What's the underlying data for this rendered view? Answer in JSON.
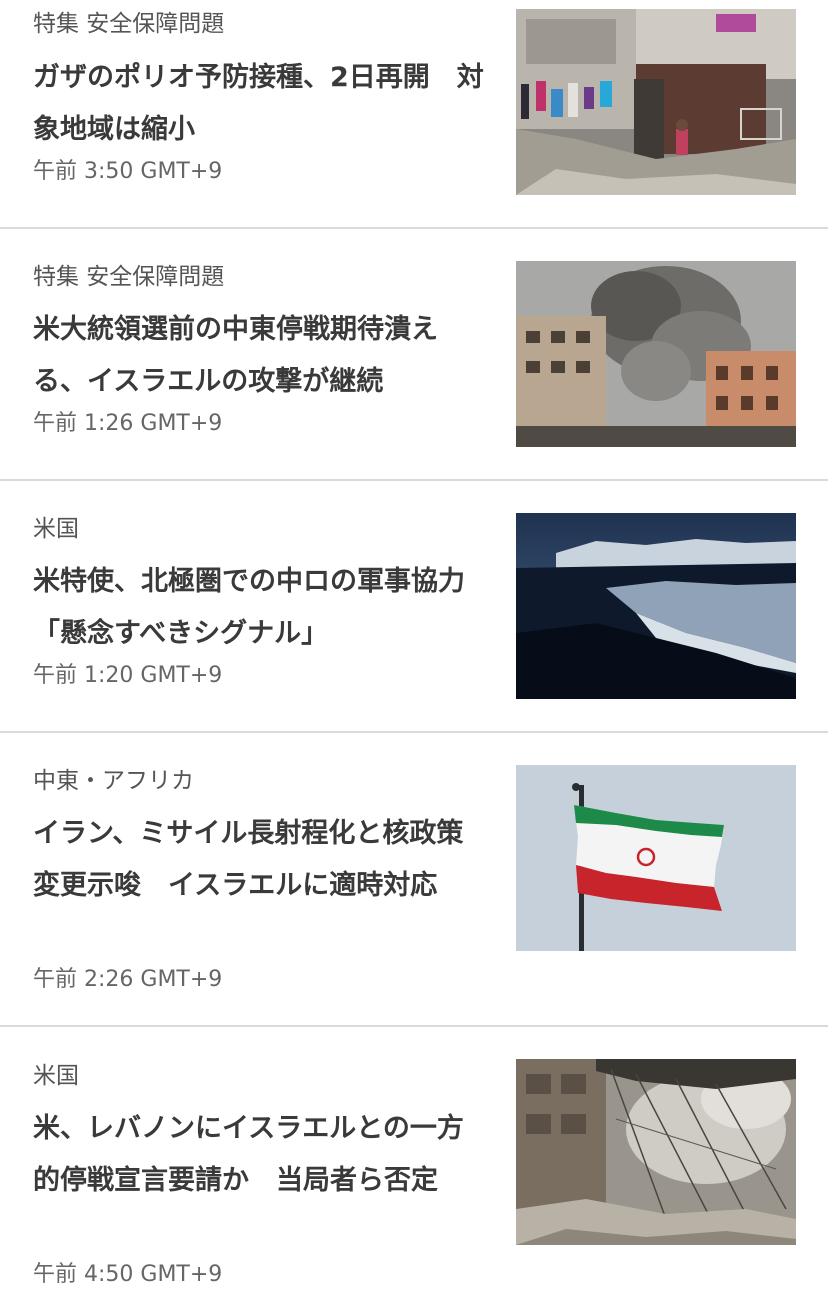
{
  "articles": [
    {
      "category": "特集 安全保障問題",
      "headline": "ガザのポリオ予防接種、2日再開　対象地域は縮小",
      "timestamp": "午前 3:50 GMT+9",
      "image": "gaza-rubble-photo"
    },
    {
      "category": "特集 安全保障問題",
      "headline": "米大統領選前の中東停戦期待潰える、イスラエルの攻撃が継続",
      "timestamp": "午前 1:26 GMT+9",
      "image": "airstrike-smoke-photo"
    },
    {
      "category": "米国",
      "headline": "米特使、北極圏での中ロの軍事協力　「懸念すべきシグナル」",
      "timestamp": "午前 1:20 GMT+9",
      "image": "arctic-coast-photo"
    },
    {
      "category": "中東・アフリカ",
      "headline": "イラン、ミサイル長射程化と核政策変更示唆　イスラエルに適時対応",
      "timestamp": "午前 2:26 GMT+9",
      "image": "iran-flag-photo"
    },
    {
      "category": "米国",
      "headline": "米、レバノンにイスラエルとの一方的停戦宣言要請か　当局者ら否定",
      "timestamp": "午前 4:50 GMT+9",
      "image": "destroyed-building-photo"
    }
  ]
}
